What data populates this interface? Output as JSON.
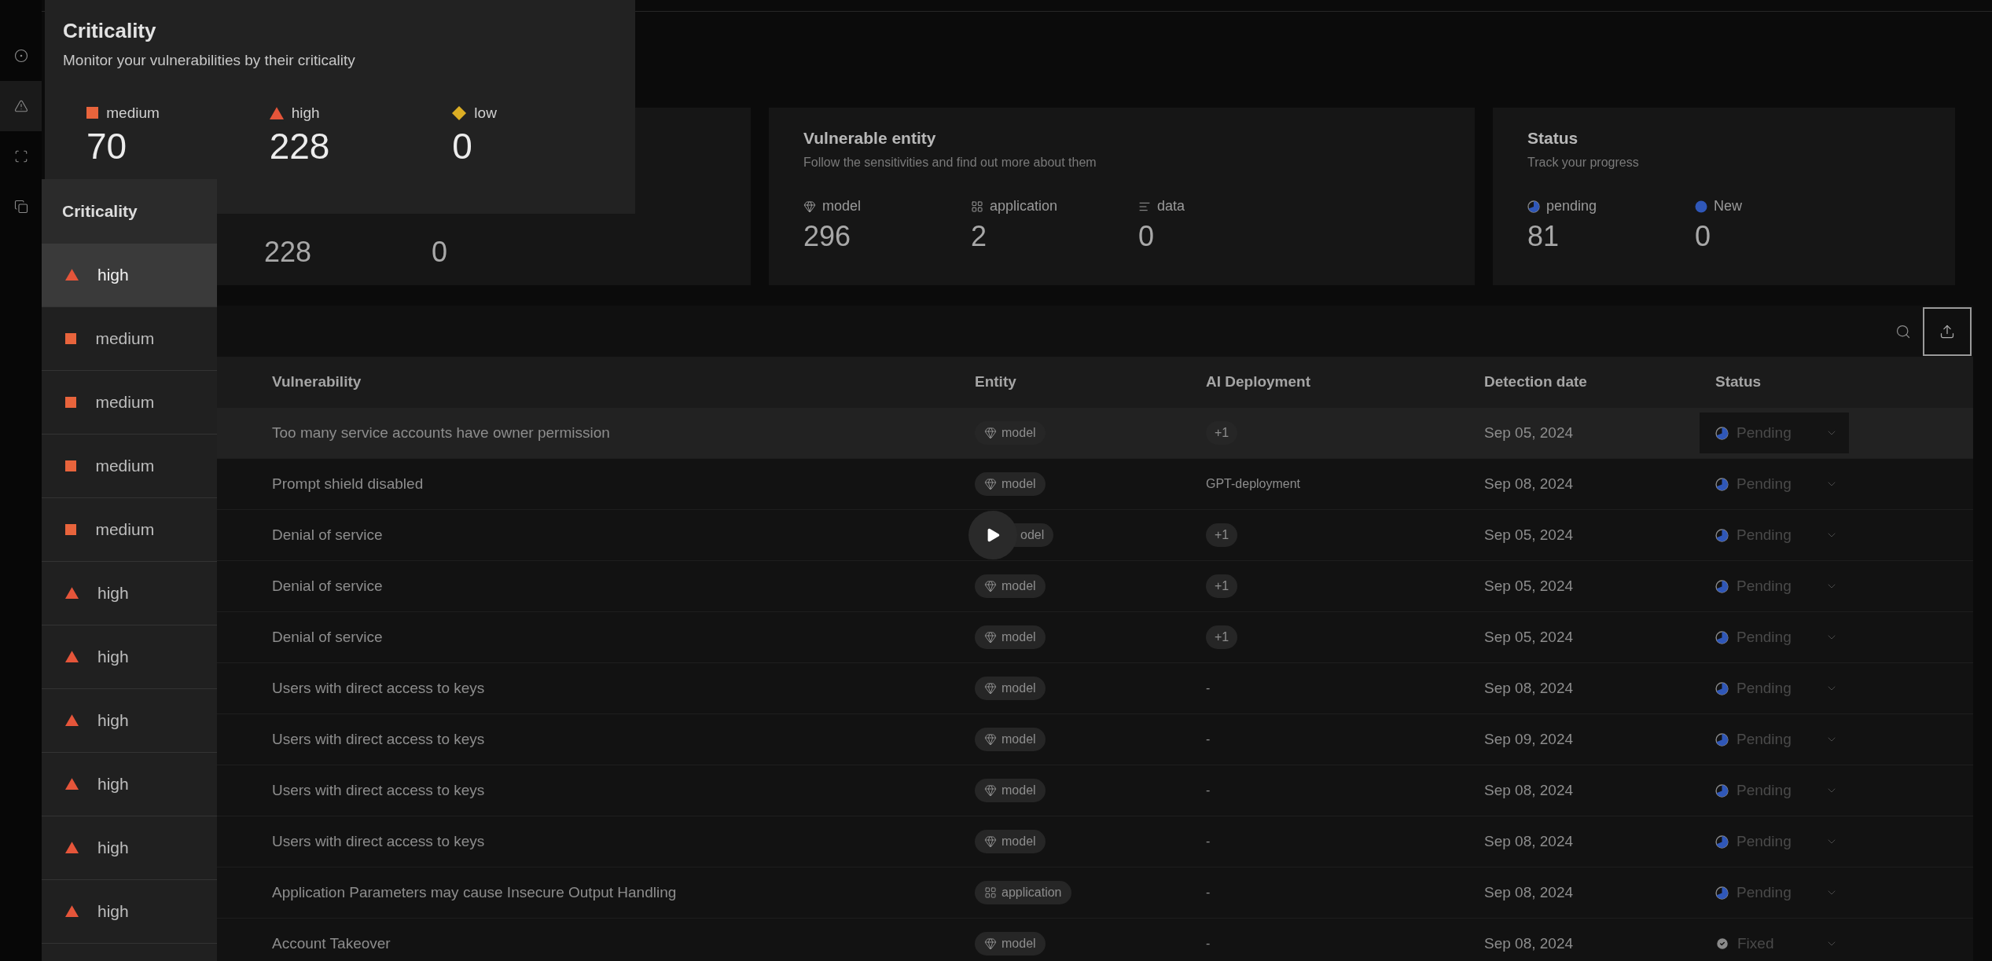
{
  "rail": {
    "items": [
      {
        "kind": "pin",
        "selected": false
      },
      {
        "kind": "alert",
        "selected": true
      },
      {
        "kind": "scan",
        "selected": false
      },
      {
        "kind": "copy",
        "selected": false
      }
    ]
  },
  "criticality_popup": {
    "title": "Criticality",
    "subtitle": "Monitor your vulnerabilities by their criticality",
    "stats": [
      {
        "kind": "medium",
        "label": "medium",
        "value": "70"
      },
      {
        "kind": "high",
        "label": "high",
        "value": "228"
      },
      {
        "kind": "low",
        "label": "low",
        "value": "0"
      }
    ]
  },
  "criticality_card": {
    "values": [
      "228",
      "0"
    ]
  },
  "entity_card": {
    "title": "Vulnerable entity",
    "subtitle": "Follow the sensitivities and find out more about them",
    "stats": [
      {
        "kind": "model",
        "label": "model",
        "value": "296"
      },
      {
        "kind": "application",
        "label": "application",
        "value": "2"
      },
      {
        "kind": "data",
        "label": "data",
        "value": "0"
      }
    ]
  },
  "status_card": {
    "title": "Status",
    "subtitle": "Track your progress",
    "stats": [
      {
        "kind": "pending",
        "label": "pending",
        "value": "81"
      },
      {
        "kind": "new",
        "label": "New",
        "value": "0"
      }
    ]
  },
  "table": {
    "columns": [
      "Vulnerability",
      "Entity",
      "AI Deployment",
      "Detection date",
      "Status"
    ],
    "rows": [
      {
        "highlighted": true,
        "vulnerability": "Too many service accounts have owner permission",
        "entity": {
          "kind": "model",
          "label": "model"
        },
        "deployment": {
          "kind": "tag",
          "text": "+1"
        },
        "date": "Sep 05, 2024",
        "status": {
          "kind": "pending",
          "label": "Pending"
        }
      },
      {
        "highlighted": false,
        "vulnerability": "Prompt shield disabled",
        "entity": {
          "kind": "model",
          "label": "model"
        },
        "deployment": {
          "kind": "text",
          "text": "GPT-deployment"
        },
        "date": "Sep 08, 2024",
        "status": {
          "kind": "pending",
          "label": "Pending"
        }
      },
      {
        "highlighted": false,
        "vulnerability": "Denial of service",
        "entity": {
          "kind": "covered",
          "label": "odel"
        },
        "deployment": {
          "kind": "tag",
          "text": "+1"
        },
        "date": "Sep 05, 2024",
        "status": {
          "kind": "pending",
          "label": "Pending"
        }
      },
      {
        "highlighted": false,
        "vulnerability": "Denial of service",
        "entity": {
          "kind": "model",
          "label": "model"
        },
        "deployment": {
          "kind": "tag",
          "text": "+1"
        },
        "date": "Sep 05, 2024",
        "status": {
          "kind": "pending",
          "label": "Pending"
        }
      },
      {
        "highlighted": false,
        "vulnerability": "Denial of service",
        "entity": {
          "kind": "model",
          "label": "model"
        },
        "deployment": {
          "kind": "tag",
          "text": "+1"
        },
        "date": "Sep 05, 2024",
        "status": {
          "kind": "pending",
          "label": "Pending"
        }
      },
      {
        "highlighted": false,
        "vulnerability": "Users with direct access to keys",
        "entity": {
          "kind": "model",
          "label": "model"
        },
        "deployment": {
          "kind": "text",
          "text": "-"
        },
        "date": "Sep 08, 2024",
        "status": {
          "kind": "pending",
          "label": "Pending"
        }
      },
      {
        "highlighted": false,
        "vulnerability": "Users with direct access to keys",
        "entity": {
          "kind": "model",
          "label": "model"
        },
        "deployment": {
          "kind": "text",
          "text": "-"
        },
        "date": "Sep 09, 2024",
        "status": {
          "kind": "pending",
          "label": "Pending"
        }
      },
      {
        "highlighted": false,
        "vulnerability": "Users with direct access to keys",
        "entity": {
          "kind": "model",
          "label": "model"
        },
        "deployment": {
          "kind": "text",
          "text": "-"
        },
        "date": "Sep 08, 2024",
        "status": {
          "kind": "pending",
          "label": "Pending"
        }
      },
      {
        "highlighted": false,
        "vulnerability": "Users with direct access to keys",
        "entity": {
          "kind": "model",
          "label": "model"
        },
        "deployment": {
          "kind": "text",
          "text": "-"
        },
        "date": "Sep 08, 2024",
        "status": {
          "kind": "pending",
          "label": "Pending"
        }
      },
      {
        "highlighted": false,
        "vulnerability": "Application Parameters may cause Insecure Output Handling",
        "entity": {
          "kind": "application",
          "label": "application"
        },
        "deployment": {
          "kind": "text",
          "text": "-"
        },
        "date": "Sep 08, 2024",
        "status": {
          "kind": "pending",
          "label": "Pending"
        }
      },
      {
        "highlighted": false,
        "vulnerability": "Account Takeover",
        "entity": {
          "kind": "model",
          "label": "model"
        },
        "deployment": {
          "kind": "text",
          "text": "-"
        },
        "date": "Sep 08, 2024",
        "status": {
          "kind": "fixed",
          "label": "Fixed"
        }
      }
    ]
  },
  "criticality_column": {
    "title": "Criticality",
    "items": [
      {
        "kind": "high",
        "label": "high",
        "highlighted": true
      },
      {
        "kind": "medium",
        "label": "medium",
        "highlighted": false
      },
      {
        "kind": "medium",
        "label": "medium",
        "highlighted": false
      },
      {
        "kind": "medium",
        "label": "medium",
        "highlighted": false
      },
      {
        "kind": "medium",
        "label": "medium",
        "highlighted": false
      },
      {
        "kind": "high",
        "label": "high",
        "highlighted": false
      },
      {
        "kind": "high",
        "label": "high",
        "highlighted": false
      },
      {
        "kind": "high",
        "label": "high",
        "highlighted": false
      },
      {
        "kind": "high",
        "label": "high",
        "highlighted": false
      },
      {
        "kind": "high",
        "label": "high",
        "highlighted": false
      },
      {
        "kind": "high",
        "label": "high",
        "highlighted": false
      }
    ]
  }
}
